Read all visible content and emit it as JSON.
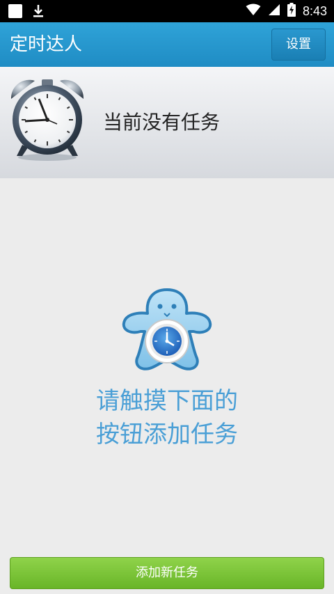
{
  "status_bar": {
    "time": "8:43",
    "icons": [
      "notification-square-icon",
      "download-icon",
      "wifi-icon",
      "signal-icon",
      "battery-charging-icon"
    ]
  },
  "app_bar": {
    "title": "定时达人",
    "settings_label": "设置"
  },
  "info_panel": {
    "icon": "alarm-clock-icon",
    "status_text": "当前没有任务"
  },
  "empty_state": {
    "mascot_icon": "mascot-with-clock-icon",
    "hint_line1": "请触摸下面的",
    "hint_line2": "按钮添加任务"
  },
  "footer": {
    "add_task_label": "添加新任务"
  },
  "colors": {
    "app_bar": "#1f8cc4",
    "hint_text": "#4a9fd6",
    "add_button": "#7cc53a"
  }
}
